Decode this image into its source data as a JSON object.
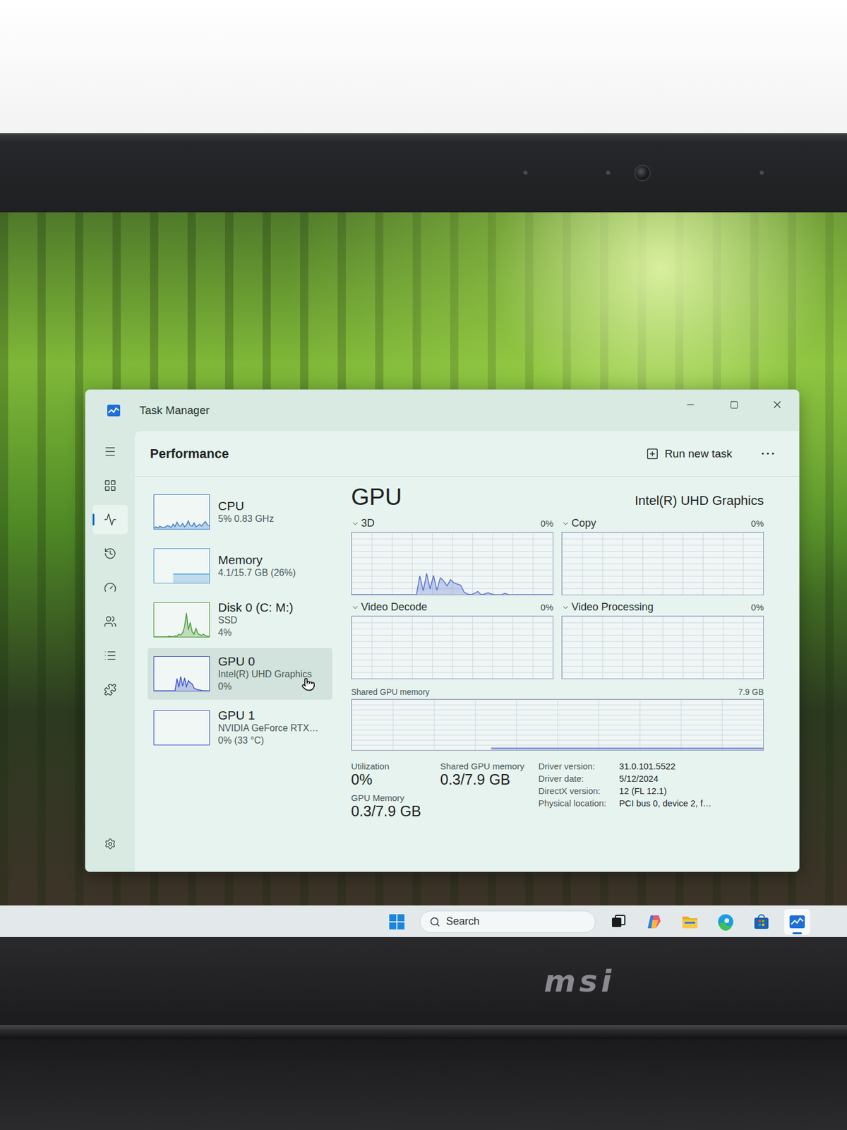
{
  "window": {
    "title": "Task Manager"
  },
  "nav": [
    {
      "selected": false
    },
    {
      "selected": true
    },
    {
      "selected": false
    },
    {
      "selected": false
    },
    {
      "selected": false
    },
    {
      "selected": false
    },
    {
      "selected": false
    }
  ],
  "header": {
    "title": "Performance",
    "run_task": "Run new task",
    "more": "⋯"
  },
  "resources": [
    {
      "name": "CPU",
      "details": [
        "5% 0.83 GHz"
      ],
      "selected": false,
      "hovered": false,
      "color": "#3d7cc9",
      "graph": [
        4,
        6,
        3,
        8,
        5,
        4,
        6,
        10,
        7,
        5,
        14,
        7,
        20,
        10,
        8,
        16,
        6,
        12,
        24,
        10,
        8,
        18,
        6,
        10,
        14,
        8,
        16,
        22,
        12,
        9
      ]
    },
    {
      "name": "Memory",
      "details": [
        "4.1/15.7 GB (26%)"
      ],
      "selected": false,
      "hovered": false,
      "color": "#4f9bd6",
      "graph": [
        26,
        26,
        26,
        26,
        26,
        26,
        26,
        26,
        26,
        26,
        26,
        26,
        26,
        26,
        26,
        26,
        26,
        26,
        26,
        26
      ]
    },
    {
      "name": "Disk 0 (C: M:)",
      "details": [
        "SSD",
        "4%"
      ],
      "selected": false,
      "hovered": false,
      "color": "#4d9a3a",
      "graph": [
        0,
        0,
        0,
        0,
        0,
        0,
        0,
        0,
        2,
        1,
        0,
        3,
        2,
        8,
        5,
        12,
        30,
        70,
        20,
        42,
        15,
        8,
        25,
        10,
        6,
        4,
        8,
        3,
        2,
        1
      ]
    },
    {
      "name": "GPU 0",
      "details": [
        "Intel(R) UHD Graphics",
        "0%"
      ],
      "selected": true,
      "hovered": true,
      "color": "#3f56c8",
      "graph": [
        0,
        0,
        0,
        0,
        0,
        0,
        0,
        0,
        0,
        0,
        0,
        0,
        36,
        10,
        42,
        14,
        38,
        12,
        30,
        24,
        20,
        8,
        5,
        3,
        2,
        1,
        0,
        0,
        0,
        0
      ]
    },
    {
      "name": "GPU 1",
      "details": [
        "NVIDIA GeForce RTX…",
        "0% (33 °C)"
      ],
      "selected": false,
      "hovered": false,
      "color": "#3f56c8",
      "graph": []
    }
  ],
  "detail": {
    "title": "GPU",
    "device": "Intel(R) UHD Graphics",
    "charts": [
      {
        "label": "3D",
        "value": "0%",
        "values": [
          0,
          0,
          0,
          0,
          0,
          0,
          0,
          0,
          0,
          0,
          0,
          0,
          0,
          0,
          0,
          0,
          0,
          0,
          0,
          0,
          30,
          6,
          34,
          9,
          31,
          7,
          27,
          22,
          14,
          24,
          19,
          17,
          15,
          4,
          1,
          0,
          2,
          5,
          0,
          1,
          3,
          1,
          0,
          0,
          0,
          2,
          0,
          0,
          0,
          0,
          0,
          0,
          0,
          0,
          0,
          0,
          0,
          0,
          0,
          0
        ]
      },
      {
        "label": "Copy",
        "value": "0%",
        "values": []
      },
      {
        "label": "Video Decode",
        "value": "0%",
        "values": []
      },
      {
        "label": "Video Processing",
        "value": "0%",
        "values": []
      }
    ],
    "shared_chart": {
      "label": "Shared GPU memory",
      "max": "7.9 GB",
      "values": [
        0.3,
        0.3,
        0.3,
        0.3,
        0.3,
        0.3,
        0.3,
        0.3,
        0.3,
        0.3,
        0.3,
        0.3,
        0.3,
        0.3,
        0.3,
        0.3,
        0.3,
        0.3,
        0.3,
        0.3,
        0.3,
        0.3,
        0.3,
        0.3,
        0.3,
        0.3,
        0.3,
        0.3,
        0.3,
        0.3,
        0.3,
        0.3,
        0.3,
        0.3,
        0.3,
        0.3,
        0.3,
        0.3,
        0.3,
        0.3
      ]
    },
    "stat_columns": [
      [
        {
          "label": "Utilization",
          "value": "0%"
        },
        {
          "label": "GPU Memory",
          "value": "0.3/7.9 GB"
        }
      ],
      [
        {
          "label": "Shared GPU memory",
          "value": "0.3/7.9 GB"
        }
      ]
    ],
    "info": [
      {
        "label": "Driver version:",
        "value": "31.0.101.5522"
      },
      {
        "label": "Driver date:",
        "value": "5/12/2024"
      },
      {
        "label": "DirectX version:",
        "value": "12 (FL 12.1)"
      },
      {
        "label": "Physical location:",
        "value": "PCI bus 0, device 2, f…"
      }
    ]
  },
  "taskbar": {
    "search_placeholder": "Search",
    "apps": [
      {
        "open": false
      },
      {
        "open": false
      },
      {
        "open": false
      },
      {
        "open": false
      },
      {
        "open": false
      },
      {
        "open": true
      }
    ]
  },
  "brand": {
    "logo": "msi"
  }
}
